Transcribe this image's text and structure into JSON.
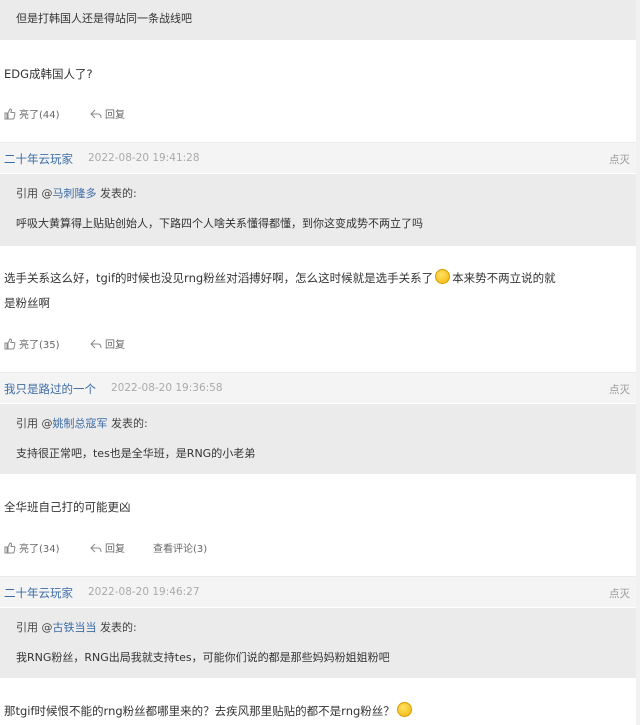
{
  "top_quote": {
    "text": "但是打韩国人还是得站同一条战线吧"
  },
  "post0": {
    "body": "EDG成韩国人了?",
    "like": "亮了(44)",
    "reply": "回复"
  },
  "post1": {
    "author": "二十年云玩家",
    "time": "2022-08-20 19:41:28",
    "dianmie": "点灭",
    "quote_prefix": "引用 @",
    "quote_user": "马刺隆多",
    "quote_suffix": " 发表的:",
    "quote_text": "呼吸大黄算得上贴贴创始人，下路四个人啥关系懂得都懂，到你这变成势不两立了吗",
    "body_line1": "选手关系这么好，tgif的时候也没见rng粉丝对滔搏好啊，怎么这时候就是选手关系了",
    "body_line1b": "本来势不两立说的就",
    "body_line2": "是粉丝啊",
    "like": "亮了(35)",
    "reply": "回复"
  },
  "post2": {
    "author": "我只是路过的一个",
    "time": "2022-08-20 19:36:58",
    "dianmie": "点灭",
    "quote_prefix": "引用 @",
    "quote_user": "姚制总寇军",
    "quote_suffix": " 发表的:",
    "quote_text": "支持很正常吧，tes也是全华班，是RNG的小老弟",
    "body": "全华班自己打的可能更凶",
    "like": "亮了(34)",
    "reply": "回复",
    "view_comments": "查看评论(3)"
  },
  "post3": {
    "author": "二十年云玩家",
    "time": "2022-08-20 19:46:27",
    "dianmie": "点灭",
    "quote_prefix": "引用 @",
    "quote_user": "古铁当当",
    "quote_suffix": " 发表的:",
    "quote_text": "我RNG粉丝，RNG出局我就支持tes，可能你们说的都是那些妈妈粉姐姐粉吧",
    "body": "那tgif时候恨不能的rng粉丝都哪里来的？去疾风那里贴贴的都不是rng粉丝？"
  }
}
